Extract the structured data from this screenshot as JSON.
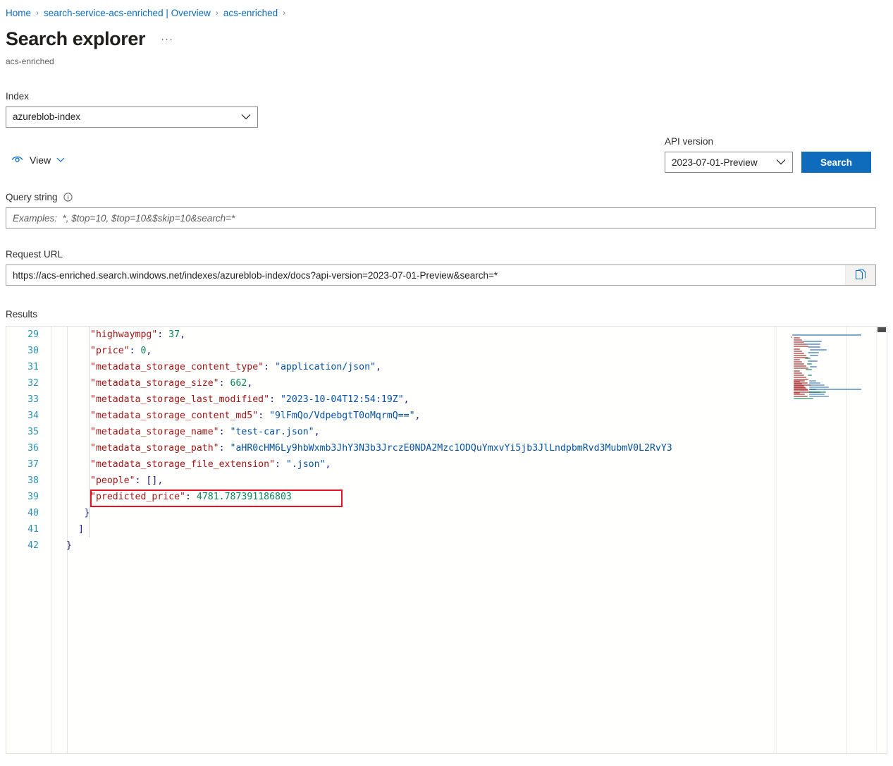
{
  "breadcrumb": {
    "items": [
      {
        "label": "Home"
      },
      {
        "label": "search-service-acs-enriched | Overview"
      },
      {
        "label": "acs-enriched"
      }
    ],
    "separator": "›"
  },
  "header": {
    "title": "Search explorer",
    "more_label": "···",
    "subtitle": "acs-enriched"
  },
  "index": {
    "label": "Index",
    "value": "azureblob-index"
  },
  "view": {
    "label": "View",
    "icon": "eye-icon",
    "chevron": "chevron-down-icon"
  },
  "api": {
    "label": "API version",
    "value": "2023-07-01-Preview",
    "search_label": "Search"
  },
  "query": {
    "label": "Query string",
    "info_icon": "info-icon",
    "placeholder": "Examples:  *, $top=10, $top=10&$skip=10&search=*",
    "value": ""
  },
  "request_url": {
    "label": "Request URL",
    "value": "https://acs-enriched.search.windows.net/indexes/azureblob-index/docs?api-version=2023-07-01-Preview&search=*",
    "copy_icon": "copy-icon"
  },
  "results": {
    "label": "Results",
    "first_line_number": 29,
    "highlight": {
      "line_number": 39,
      "color": "#e81123"
    },
    "colors": {
      "key": "#a31515",
      "string": "#0451a5",
      "number": "#098658",
      "punctuation": "#1b1b8f",
      "line_number": "#2b91af"
    },
    "lines": [
      {
        "n": 29,
        "indent": 4,
        "tokens": [
          {
            "t": "key",
            "v": "\"highwaympg\""
          },
          {
            "t": "pun",
            "v": ": "
          },
          {
            "t": "num",
            "v": "37"
          },
          {
            "t": "pun",
            "v": ","
          }
        ]
      },
      {
        "n": 30,
        "indent": 4,
        "tokens": [
          {
            "t": "key",
            "v": "\"price\""
          },
          {
            "t": "pun",
            "v": ": "
          },
          {
            "t": "num",
            "v": "0"
          },
          {
            "t": "pun",
            "v": ","
          }
        ]
      },
      {
        "n": 31,
        "indent": 4,
        "tokens": [
          {
            "t": "key",
            "v": "\"metadata_storage_content_type\""
          },
          {
            "t": "pun",
            "v": ": "
          },
          {
            "t": "str",
            "v": "\"application/json\""
          },
          {
            "t": "pun",
            "v": ","
          }
        ]
      },
      {
        "n": 32,
        "indent": 4,
        "tokens": [
          {
            "t": "key",
            "v": "\"metadata_storage_size\""
          },
          {
            "t": "pun",
            "v": ": "
          },
          {
            "t": "num",
            "v": "662"
          },
          {
            "t": "pun",
            "v": ","
          }
        ]
      },
      {
        "n": 33,
        "indent": 4,
        "tokens": [
          {
            "t": "key",
            "v": "\"metadata_storage_last_modified\""
          },
          {
            "t": "pun",
            "v": ": "
          },
          {
            "t": "str",
            "v": "\"2023-10-04T12:54:19Z\""
          },
          {
            "t": "pun",
            "v": ","
          }
        ]
      },
      {
        "n": 34,
        "indent": 4,
        "tokens": [
          {
            "t": "key",
            "v": "\"metadata_storage_content_md5\""
          },
          {
            "t": "pun",
            "v": ": "
          },
          {
            "t": "str",
            "v": "\"9lFmQo/VdpebgtT0oMqrmQ==\""
          },
          {
            "t": "pun",
            "v": ","
          }
        ]
      },
      {
        "n": 35,
        "indent": 4,
        "tokens": [
          {
            "t": "key",
            "v": "\"metadata_storage_name\""
          },
          {
            "t": "pun",
            "v": ": "
          },
          {
            "t": "str",
            "v": "\"test-car.json\""
          },
          {
            "t": "pun",
            "v": ","
          }
        ]
      },
      {
        "n": 36,
        "indent": 4,
        "tokens": [
          {
            "t": "key",
            "v": "\"metadata_storage_path\""
          },
          {
            "t": "pun",
            "v": ": "
          },
          {
            "t": "str",
            "v": "\"aHR0cHM6Ly9hbWxmb3JhY3N3b3JrczE0NDA2Mzc1ODQuYmxvYi5jb3JlLndpbmRvd3MubmV0L2RvY3"
          }
        ]
      },
      {
        "n": 37,
        "indent": 4,
        "tokens": [
          {
            "t": "key",
            "v": "\"metadata_storage_file_extension\""
          },
          {
            "t": "pun",
            "v": ": "
          },
          {
            "t": "str",
            "v": "\".json\""
          },
          {
            "t": "pun",
            "v": ","
          }
        ]
      },
      {
        "n": 38,
        "indent": 4,
        "tokens": [
          {
            "t": "key",
            "v": "\"people\""
          },
          {
            "t": "pun",
            "v": ": "
          },
          {
            "t": "brk",
            "v": "[]"
          },
          {
            "t": "pun",
            "v": ","
          }
        ]
      },
      {
        "n": 39,
        "indent": 4,
        "tokens": [
          {
            "t": "key",
            "v": "\"predicted_price\""
          },
          {
            "t": "pun",
            "v": ": "
          },
          {
            "t": "num",
            "v": "4781.787391186803"
          }
        ]
      },
      {
        "n": 40,
        "indent": 3,
        "tokens": [
          {
            "t": "brk",
            "v": "}"
          }
        ]
      },
      {
        "n": 41,
        "indent": 2,
        "tokens": [
          {
            "t": "brk",
            "v": "]"
          }
        ]
      },
      {
        "n": 42,
        "indent": 0,
        "tokens": [
          {
            "t": "brk",
            "v": "}"
          }
        ]
      }
    ]
  }
}
